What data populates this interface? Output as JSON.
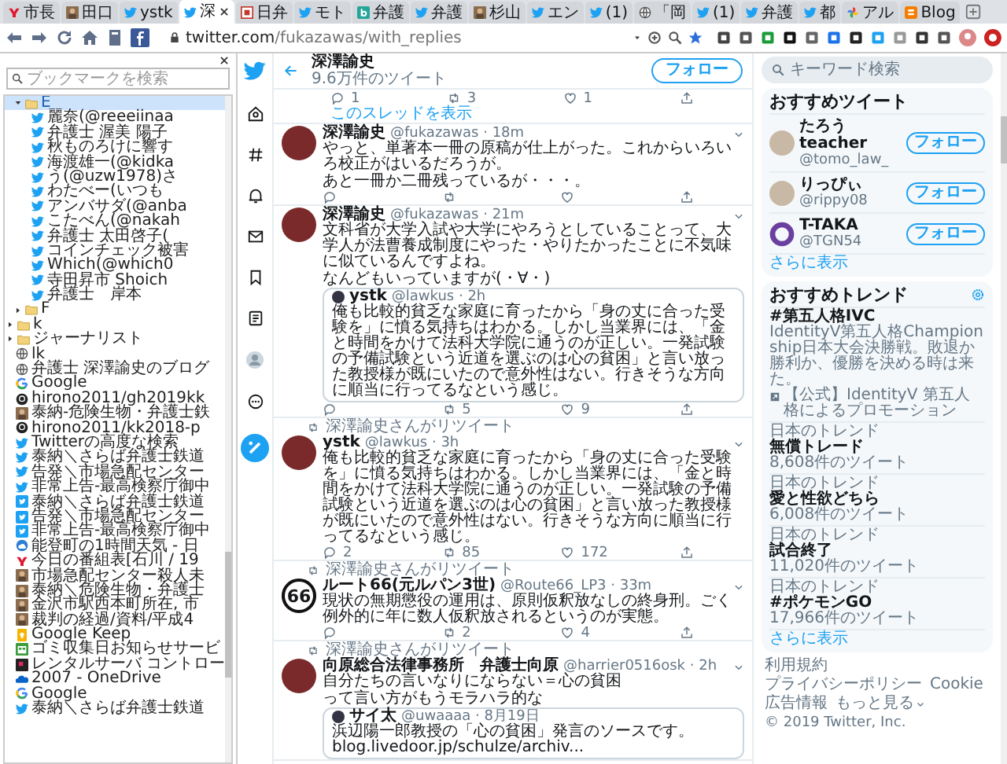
{
  "browser": {
    "tabs": [
      {
        "label": "市長",
        "kind": "yahoo",
        "selected": false
      },
      {
        "label": "田口",
        "kind": "image",
        "selected": false
      },
      {
        "label": "ystk",
        "kind": "twitter",
        "selected": false
      },
      {
        "label": "深",
        "kind": "twitter",
        "selected": true
      },
      {
        "label": "日弁",
        "kind": "square-red",
        "selected": false
      },
      {
        "label": "モト",
        "kind": "twitter",
        "selected": false
      },
      {
        "label": "弁護",
        "kind": "square-teal",
        "selected": false
      },
      {
        "label": "弁護",
        "kind": "twitter",
        "selected": false
      },
      {
        "label": "杉山",
        "kind": "image",
        "selected": false
      },
      {
        "label": "エン",
        "kind": "twitter",
        "selected": false
      },
      {
        "label": "(1)",
        "kind": "twitter",
        "selected": false
      },
      {
        "label": "「岡",
        "kind": "globe",
        "selected": false
      },
      {
        "label": "(1)",
        "kind": "twitter",
        "selected": false
      },
      {
        "label": "弁護",
        "kind": "twitter",
        "selected": false
      },
      {
        "label": "都",
        "kind": "twitter",
        "selected": false
      },
      {
        "label": "アル",
        "kind": "pinwheel",
        "selected": false
      },
      {
        "label": "Blog",
        "kind": "blogger",
        "selected": false
      }
    ],
    "address": {
      "host": "twitter.com",
      "path": "/fukazawas/with_replies"
    }
  },
  "bookmarks": {
    "search": {
      "placeholder": "ブックマークを検索"
    },
    "tree": [
      {
        "kind": "group",
        "children": [
          {
            "label": "E",
            "kind": "folder",
            "expanded": true,
            "selected": true,
            "children": [
              {
                "label": "麗奈(@reeeiinaa",
                "kind": "twitter",
                "selected": false
              },
              {
                "label": "弁護士 渥美 陽子",
                "kind": "twitter",
                "selected": false
              },
              {
                "label": "秋ものろけに響す",
                "kind": "twitter",
                "selected": false
              },
              {
                "label": "海渡雄一(@kidka",
                "kind": "twitter",
                "selected": false
              },
              {
                "label": "う(@uzw1978)さ",
                "kind": "twitter",
                "selected": false
              },
              {
                "label": "わたべー(いつも",
                "kind": "twitter",
                "selected": false
              },
              {
                "label": "アンバサダ(@anba",
                "kind": "twitter",
                "selected": false
              },
              {
                "label": "こたべん(@nakah",
                "kind": "twitter",
                "selected": false
              },
              {
                "label": "弁護士 太田啓子(",
                "kind": "twitter",
                "selected": false
              },
              {
                "label": "コインチェック被害",
                "kind": "twitter",
                "selected": false
              },
              {
                "label": "Which(@which0",
                "kind": "twitter",
                "selected": false
              },
              {
                "label": "寺田昇市 Shoich",
                "kind": "twitter",
                "selected": false
              },
              {
                "label": "弁護士　岸本",
                "kind": "twitter",
                "selected": false
              }
            ]
          },
          {
            "label": "F",
            "kind": "folder",
            "expanded": false,
            "selected": false
          }
        ]
      },
      {
        "label": "k",
        "kind": "folder",
        "expanded": false,
        "selected": false
      },
      {
        "label": "ジャーナリスト",
        "kind": "folder",
        "expanded": false,
        "selected": false
      },
      {
        "label": "lk",
        "kind": "globe",
        "selected": false
      },
      {
        "label": "弁護士 深澤諭史のブログ",
        "kind": "globe",
        "selected": false
      },
      {
        "label": "Google",
        "kind": "google",
        "selected": false
      },
      {
        "label": "hirono2011/gh2019kk",
        "kind": "github",
        "selected": false
      },
      {
        "label": "泰納-危険生物・弁護士鉄",
        "kind": "image",
        "selected": false
      },
      {
        "label": "hirono2011/kk2018-p",
        "kind": "github",
        "selected": false
      },
      {
        "label": "Twitterの高度な検索",
        "kind": "twitter",
        "selected": false
      },
      {
        "label": "泰納＼さらば弁護士鉄道",
        "kind": "twitter",
        "selected": false
      },
      {
        "label": "告発＼市場急配センター",
        "kind": "twitter",
        "selected": false
      },
      {
        "label": "非常上告-最高検察庁御中",
        "kind": "twitter",
        "selected": false
      },
      {
        "label": "泰納＼さらば弁護士鉄道",
        "kind": "twitter-square",
        "selected": false
      },
      {
        "label": "告発＼市場急配センター",
        "kind": "twitter-square",
        "selected": false
      },
      {
        "label": "非常上告-最高検察庁御中",
        "kind": "twitter-square",
        "selected": false
      },
      {
        "label": "能登町の1時間天気 - 日",
        "kind": "weather",
        "selected": false
      },
      {
        "label": "今日の番組表[石川 / 19",
        "kind": "yahoo",
        "selected": false
      },
      {
        "label": "市場急配センター殺人未",
        "kind": "image",
        "selected": false
      },
      {
        "label": "泰納＼危険生物・弁護士",
        "kind": "image",
        "selected": false
      },
      {
        "label": "金沢市駅西本町所在, 市",
        "kind": "image",
        "selected": false
      },
      {
        "label": "裁判の経過/資料/平成4",
        "kind": "image",
        "selected": false
      },
      {
        "label": "Google Keep",
        "kind": "keep",
        "selected": false
      },
      {
        "label": "ゴミ収集日お知らせサービ",
        "kind": "square-green",
        "selected": false
      },
      {
        "label": "レンタルサーバ コントロー",
        "kind": "square-dark",
        "selected": false
      },
      {
        "label": "2007 - OneDrive",
        "kind": "onedrive",
        "selected": false
      },
      {
        "label": "Google",
        "kind": "google",
        "selected": false
      },
      {
        "label": "泰納＼さらば弁護士鉄道",
        "kind": "twitter",
        "selected": false
      }
    ]
  },
  "profile": {
    "name": "深澤諭史",
    "tweet_count": "9.6万件のツイート",
    "follow_button": "フォロー"
  },
  "previous_tweet_actions": {
    "reply": "1",
    "retweet": "3",
    "like": "1"
  },
  "thread_link": "このスレッドを表示",
  "tweets": [
    {
      "name": "深澤諭史",
      "meta": "@fukazawas · 18m",
      "paragraphs": [
        "やっと、単著本一冊の原稿が仕上がった。これからいろいろ校正がはいるだろうが。",
        "あと一冊か二冊残っているが・・・。"
      ]
    },
    {
      "name": "深澤諭史",
      "meta": "@fukazawas · 21m",
      "paragraphs": [
        "文科省が大学入試や大学にやろうとしていることって、大学人が法曹養成制度にやった・やりたかったことに不気味に似ているんですよね。",
        "なんどもいっていますが(・∀・)"
      ],
      "quote": {
        "name": "ystk",
        "meta": "@lawkus · 2h",
        "paragraphs": [
          "俺も比較的貧乏な家庭に育ったから「身の丈に合った受験を」に憤る気持ちはわかる。しかし当業界には、「金と時間をかけて法科大学院に通うのが正しい。一発試験の予備試験という近道を選ぶのは心の貧困」と言い放った教授様が既にいたので意外性はない。行きそうな方向に順当に行ってるなという感じ。"
        ]
      },
      "actions": {
        "retweet": "5",
        "like": "9"
      }
    },
    {
      "retweeted_by": "深澤諭史さんがリツイート",
      "name": "ystk",
      "meta": "@lawkus · 3h",
      "paragraphs": [
        "俺も比較的貧乏な家庭に育ったから「身の丈に合った受験を」に憤る気持ちはわかる。しかし当業界には、「金と時間をかけて法科大学院に通うのが正しい。一発試験の予備試験という近道を選ぶのは心の貧困」と言い放った教授様が既にいたので意外性はない。行きそうな方向に順当に行ってるなという感じ。"
      ],
      "actions": {
        "reply": "2",
        "retweet": "85",
        "like": "172"
      }
    },
    {
      "retweeted_by": "深澤諭史さんがリツイート",
      "avatar_text": "66",
      "name": "ルート66(元ルパン3世)",
      "meta": "@Route66_LP3 · 33m",
      "paragraphs": [
        "現状の無期懲役の運用は、原則仮釈放なしの終身刑。ごく例外的に年に数人仮釈放されるというのが実態。"
      ],
      "actions": {
        "retweet": "2",
        "like": "4"
      }
    },
    {
      "retweeted_by": "深澤諭史さんがリツイート",
      "name": "向原総合法律事務所　弁護士向原",
      "meta": "@harrier0516osk · 2h",
      "paragraphs": [
        "自分たちの言いなりにならない＝心の貧困",
        "って言い方がもうモラハラ的な"
      ],
      "quote": {
        "name": "サイ太",
        "meta": "@uwaaaa · 8月19日",
        "paragraphs": [
          "浜辺陽一郎教授の「心の貧困」発言のソースです。",
          "blog.livedoor.jp/schulze/archiv..."
        ]
      }
    }
  ],
  "sidebar": {
    "search": {
      "placeholder": "キーワード検索"
    },
    "who_to_follow": {
      "title": "おすすめツイート",
      "users": [
        {
          "name": "たろう teacher",
          "handle": "@tomo_law_",
          "kind": "photo",
          "button": "フォロー"
        },
        {
          "name": "りっぴぃ",
          "handle": "@rippy08",
          "kind": "photo",
          "button": "フォロー"
        },
        {
          "name": "T-TAKA",
          "handle": "@TGN54",
          "kind": "logo",
          "button": "フォロー"
        }
      ],
      "more": "さらに表示"
    },
    "trends": {
      "title": "おすすめトレンド",
      "items": [
        {
          "kind": "promoted",
          "name": "#第五人格IVC",
          "description": "IdentityV第五人格Championship日本大会決勝戦。敗退か勝利か、優勝を決める時は来た。",
          "promoter": "【公式】IdentityV 第五人格によるプロモーション"
        },
        {
          "kind": "trend",
          "context": "日本のトレンド",
          "name": "無償トレード",
          "count": "8,608件のツイート"
        },
        {
          "kind": "trend",
          "context": "日本のトレンド",
          "name": "愛と性欲どちら",
          "count": "6,008件のツイート"
        },
        {
          "kind": "trend",
          "context": "日本のトレンド",
          "name": "試合終了",
          "count": "11,020件のツイート"
        },
        {
          "kind": "trend",
          "context": "日本のトレンド",
          "name": "#ポケモンGO",
          "count": "17,966件のツイート"
        }
      ],
      "more": "さらに表示"
    },
    "footer": {
      "links": [
        "利用規約",
        "プライバシーポリシー",
        "Cookie",
        "広告情報"
      ],
      "more": "もっと見る",
      "copyright": "© 2019 Twitter, Inc."
    }
  }
}
